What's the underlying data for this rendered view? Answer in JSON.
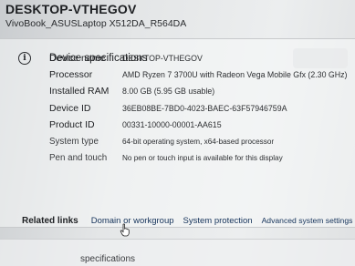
{
  "device": {
    "name": "DESKTOP-VTHEGOV",
    "model": "VivoBook_ASUSLaptop X512DA_R564DA"
  },
  "specs": {
    "title": "Device specifications",
    "rows": [
      {
        "label": "Device name",
        "value": "DESKTOP-VTHEGOV"
      },
      {
        "label": "Processor",
        "value": "AMD Ryzen 7 3700U with Radeon Vega Mobile Gfx   (2.30 GHz)"
      },
      {
        "label": "Installed RAM",
        "value": "8.00 GB (5.95 GB usable)"
      },
      {
        "label": "Device ID",
        "value": "36EB08BE-7BD0-4023-BAEC-63F57946759A"
      },
      {
        "label": "Product ID",
        "value": "00331-10000-00001-AA615"
      },
      {
        "label": "System type",
        "value": "64-bit operating system, x64-based processor"
      },
      {
        "label": "Pen and touch",
        "value": "No pen or touch input is available for this display"
      }
    ]
  },
  "related": {
    "label": "Related links",
    "links": [
      "Domain or workgroup",
      "System protection",
      "Advanced system settings"
    ]
  },
  "footer": {
    "partial_title": "specifications"
  }
}
